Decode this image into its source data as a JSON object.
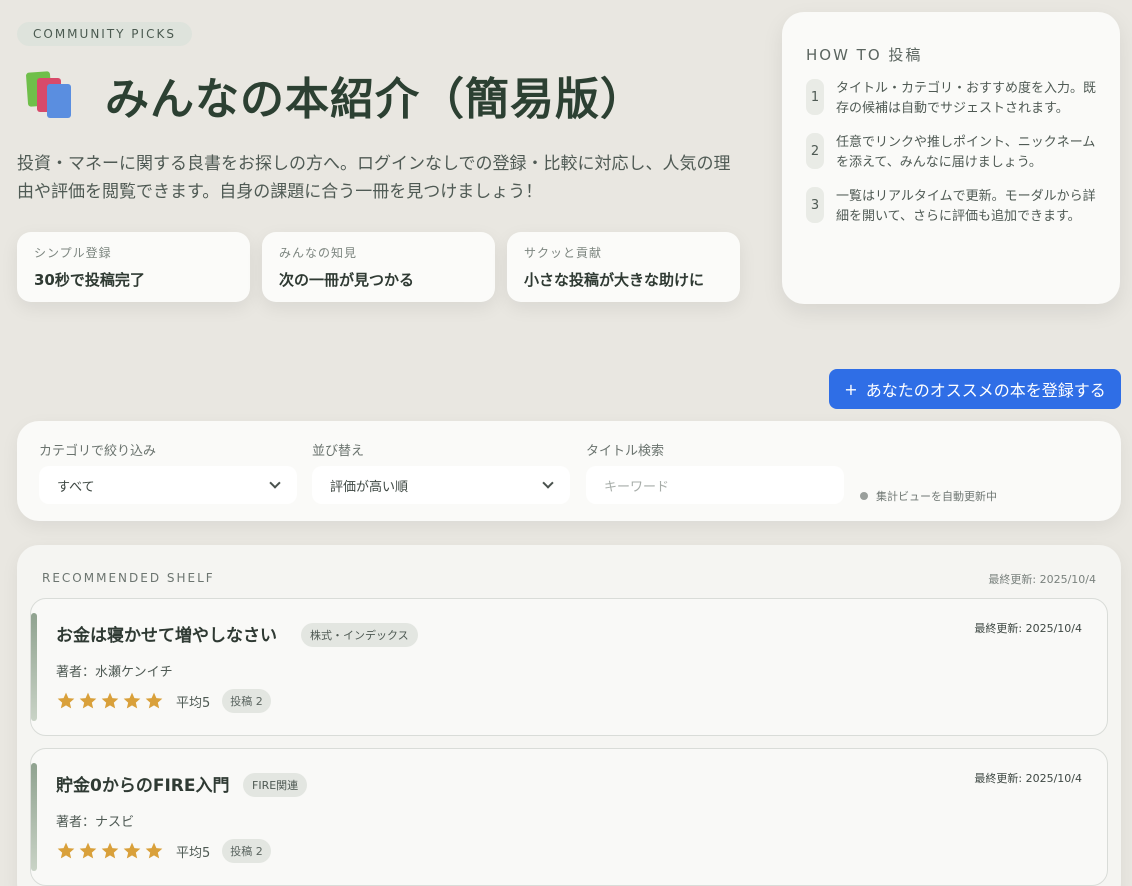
{
  "hero": {
    "eyebrow": "COMMUNITY PICKS",
    "title": "みんなの本紹介（簡易版）",
    "lead": "投資・マネーに関する良書をお探しの方へ。ログインなしでの登録・比較に対応し、人気の理由や評価を閲覧できます。自身の課題に合う一冊を見つけましょう！",
    "features": [
      {
        "label": "シンプル登録",
        "value": "30秒で投稿完了"
      },
      {
        "label": "みんなの知見",
        "value": "次の一冊が見つかる"
      },
      {
        "label": "サクッと貢献",
        "value": "小さな投稿が大きな助けに"
      }
    ]
  },
  "howto": {
    "title": "HOW TO 投稿",
    "steps": [
      {
        "num": "1",
        "text": "タイトル・カテゴリ・おすすめ度を入力。既存の候補は自動でサジェストされます。"
      },
      {
        "num": "2",
        "text": "任意でリンクや推しポイント、ニックネームを添えて、みんなに届けましょう。"
      },
      {
        "num": "3",
        "text": "一覧はリアルタイムで更新。モーダルから詳細を開いて、さらに評価も追加できます。"
      }
    ]
  },
  "register_button": {
    "icon": "+",
    "label": "あなたのオススメの本を登録する"
  },
  "filters": {
    "category_label": "カテゴリで絞り込み",
    "category_value": "すべて",
    "sort_label": "並び替え",
    "sort_value": "評価が高い順",
    "search_label": "タイトル検索",
    "search_placeholder": "キーワード",
    "status": "集計ビューを自動更新中"
  },
  "shelf": {
    "label": "RECOMMENDED SHELF",
    "updated": "最終更新: 2025/10/4",
    "books": [
      {
        "title": "お金は寝かせて増やしなさい",
        "category": "株式・インデックス",
        "author": "著者：水瀬ケンイチ",
        "rating": 5,
        "avg": "平均5",
        "count": "投稿 2",
        "updated": "最終更新: 2025/10/4"
      },
      {
        "title": "貯金0からのFIRE入門",
        "category": "FIRE関連",
        "author": "著者：ナスビ",
        "rating": 5,
        "avg": "平均5",
        "count": "投稿 2",
        "updated": "最終更新: 2025/10/4"
      }
    ]
  },
  "colors": {
    "accent": "#2f6ee6",
    "star": "#d9a03a",
    "title": "#2c4032"
  }
}
